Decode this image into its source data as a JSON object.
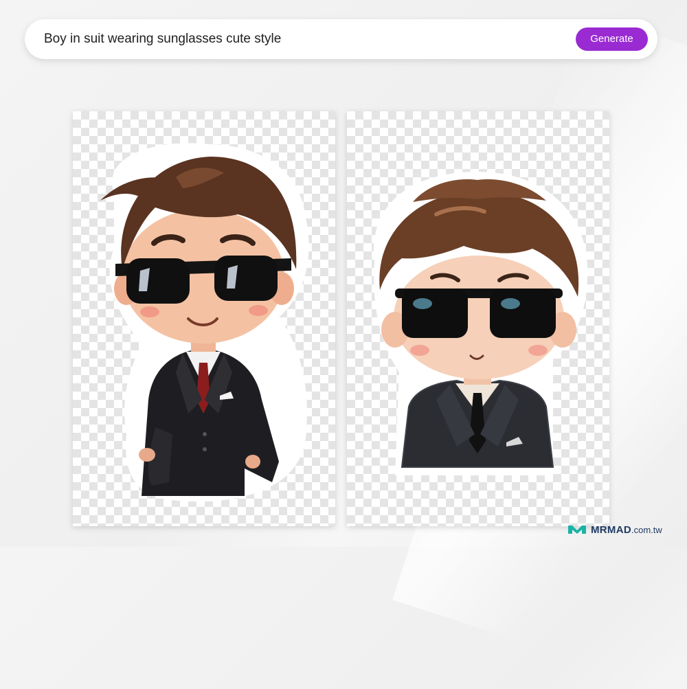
{
  "prompt": {
    "text": "Boy in suit wearing sunglasses cute style"
  },
  "generate_button": {
    "label": "Generate",
    "color": "#9a2bd3"
  },
  "results": [
    {
      "name": "sticker-result-1",
      "subject": "chibi boy in black suit with red tie and sunglasses"
    },
    {
      "name": "sticker-result-2",
      "subject": "chibi boy in plaid suit with black tie and sunglasses"
    }
  ],
  "watermark": {
    "brand": "MRMAD",
    "domain": ".com.tw",
    "color": "#1f3b63"
  }
}
